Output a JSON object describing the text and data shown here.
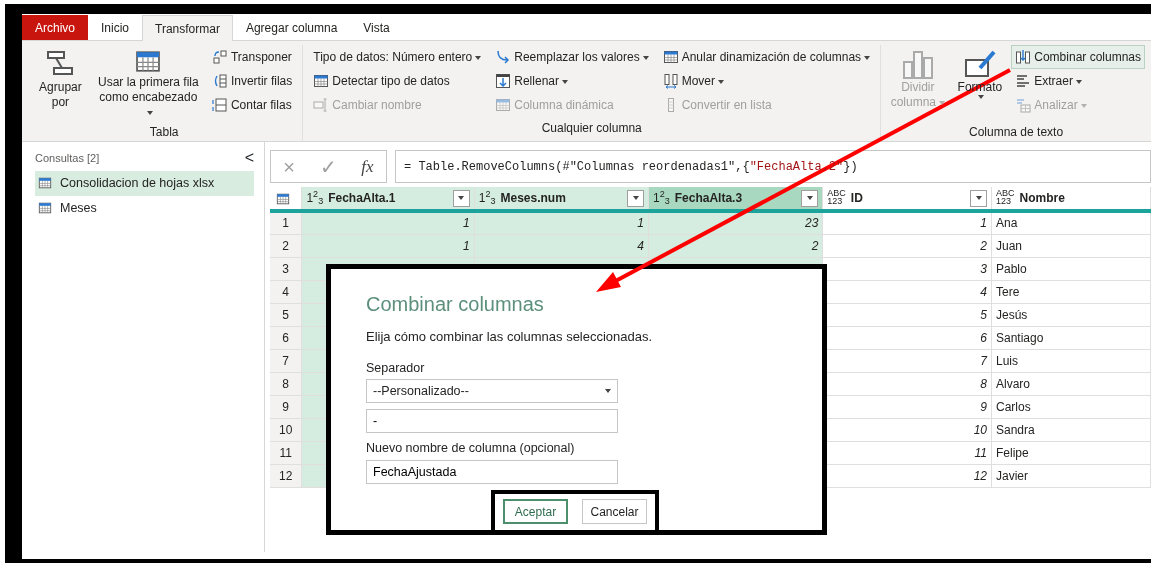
{
  "tabs": [
    {
      "label": "Archivo",
      "kind": "file",
      "selected": false
    },
    {
      "label": "Inicio",
      "kind": "tab",
      "selected": false
    },
    {
      "label": "Transformar",
      "kind": "tab",
      "selected": true
    },
    {
      "label": "Agregar columna",
      "kind": "tab",
      "selected": false
    },
    {
      "label": "Vista",
      "kind": "tab",
      "selected": false
    }
  ],
  "ribbon_groups": [
    {
      "label": "Tabla",
      "columns": [
        [
          {
            "label": "Agrupar por",
            "kind": "large",
            "dropdown": false,
            "disabled": false,
            "highlighted": false
          }
        ],
        [
          {
            "label": "Usar la primera fila como encabezado",
            "kind": "large",
            "dropdown": true,
            "disabled": false,
            "highlighted": false
          }
        ],
        [
          {
            "label": "Transponer",
            "kind": "small",
            "dropdown": false,
            "disabled": false,
            "highlighted": false
          },
          {
            "label": "Invertir filas",
            "kind": "small",
            "dropdown": false,
            "disabled": false,
            "highlighted": false
          },
          {
            "label": "Contar filas",
            "kind": "small",
            "dropdown": false,
            "disabled": false,
            "highlighted": false
          }
        ]
      ]
    },
    {
      "label": "Cualquier columna",
      "columns": [
        [
          {
            "label": "Tipo de datos: Número entero",
            "kind": "plain",
            "dropdown": true,
            "disabled": false,
            "highlighted": false
          },
          {
            "label": "Detectar tipo de datos",
            "kind": "small",
            "dropdown": false,
            "disabled": false,
            "highlighted": false
          },
          {
            "label": "Cambiar nombre",
            "kind": "small",
            "dropdown": false,
            "disabled": true,
            "highlighted": false
          }
        ],
        [
          {
            "label": "Reemplazar los valores",
            "kind": "small",
            "dropdown": true,
            "disabled": false,
            "highlighted": false
          },
          {
            "label": "Rellenar",
            "kind": "small",
            "dropdown": true,
            "disabled": false,
            "highlighted": false
          },
          {
            "label": "Columna dinámica",
            "kind": "small",
            "dropdown": false,
            "disabled": true,
            "highlighted": false
          }
        ],
        [
          {
            "label": "Anular dinamización de columnas",
            "kind": "small",
            "dropdown": true,
            "disabled": false,
            "highlighted": false
          },
          {
            "label": "Mover",
            "kind": "small",
            "dropdown": true,
            "disabled": false,
            "highlighted": false
          },
          {
            "label": "Convertir en lista",
            "kind": "small",
            "dropdown": false,
            "disabled": true,
            "highlighted": false
          }
        ]
      ]
    },
    {
      "label": "Columna de texto",
      "columns": [
        [
          {
            "label": "Dividir columna",
            "kind": "large",
            "dropdown": true,
            "disabled": true,
            "highlighted": false
          }
        ],
        [
          {
            "label": "Formato",
            "kind": "large",
            "dropdown": true,
            "disabled": false,
            "highlighted": false
          }
        ],
        [
          {
            "label": "Combinar columnas",
            "kind": "small",
            "dropdown": false,
            "disabled": false,
            "highlighted": true
          },
          {
            "label": "Extraer",
            "kind": "small",
            "dropdown": true,
            "disabled": false,
            "highlighted": false
          },
          {
            "label": "Analizar",
            "kind": "small",
            "dropdown": true,
            "disabled": true,
            "highlighted": false
          }
        ]
      ]
    }
  ],
  "queries": {
    "title": "Consultas [2]",
    "collapse": "<",
    "items": [
      {
        "label": "Consolidacion de hojas xlsx",
        "selected": true
      },
      {
        "label": "Meses",
        "selected": false
      }
    ]
  },
  "formula_bar": {
    "cancel": "×",
    "confirm": "✓",
    "fx": "fx",
    "segments": [
      {
        "text": "= Table.RemoveColumns(#\"Columnas reordenadas1\",{",
        "kind": "code"
      },
      {
        "text": "\"FechaAlta.2\"",
        "kind": "string"
      },
      {
        "text": "})",
        "kind": "code"
      }
    ]
  },
  "table": {
    "columns": [
      {
        "type_lines": [
          "1$^{2}$$_{3}$"
        ],
        "label": "FechaAlta.1",
        "kind": "number",
        "selected": true,
        "focused": false
      },
      {
        "type_lines": [
          "1$^{2}$$_{3}$"
        ],
        "label": "Meses.num",
        "kind": "number",
        "selected": true,
        "focused": false
      },
      {
        "type_lines": [
          "1$^{2}$$_{3}$"
        ],
        "label": "FechaAlta.3",
        "kind": "number",
        "selected": true,
        "focused": true
      },
      {
        "type_lines": [
          "ABC",
          "123"
        ],
        "label": "ID",
        "kind": "number",
        "selected": false,
        "focused": false
      },
      {
        "type_lines": [
          "ABC",
          "123"
        ],
        "label": "Nombre",
        "kind": "text",
        "selected": false,
        "focused": false
      }
    ],
    "rows": [
      {
        "number": "1",
        "cells": [
          "1",
          "1",
          "23",
          "1",
          "Ana"
        ]
      },
      {
        "number": "2",
        "cells": [
          "1",
          "4",
          "2",
          "2",
          "Juan"
        ]
      },
      {
        "number": "3",
        "cells": [
          null,
          null,
          null,
          "3",
          "Pablo"
        ]
      },
      {
        "number": "4",
        "cells": [
          null,
          null,
          null,
          "4",
          "Tere"
        ]
      },
      {
        "number": "5",
        "cells": [
          null,
          null,
          null,
          "5",
          "Jesús"
        ]
      },
      {
        "number": "6",
        "cells": [
          null,
          null,
          null,
          "6",
          "Santiago"
        ]
      },
      {
        "number": "7",
        "cells": [
          null,
          null,
          null,
          "7",
          "Luis"
        ]
      },
      {
        "number": "8",
        "cells": [
          null,
          null,
          null,
          "8",
          "Alvaro"
        ]
      },
      {
        "number": "9",
        "cells": [
          null,
          null,
          null,
          "9",
          "Carlos"
        ]
      },
      {
        "number": "10",
        "cells": [
          null,
          null,
          null,
          "10",
          "Sandra"
        ]
      },
      {
        "number": "11",
        "cells": [
          null,
          null,
          null,
          "11",
          "Felipe"
        ]
      },
      {
        "number": "12",
        "cells": [
          null,
          null,
          null,
          "12",
          "Javier"
        ]
      }
    ]
  },
  "dialog": {
    "title": "Combinar columnas",
    "description": "Elija cómo combinar las columnas seleccionadas.",
    "separator_label": "Separador",
    "separator_select": "--Personalizado--",
    "separator_value": "-",
    "name_label": "Nuevo nombre de columna (opcional)",
    "name_value": "FechaAjustada",
    "buttons": [
      {
        "label": "Aceptar",
        "kind": "primary"
      },
      {
        "label": "Cancelar",
        "kind": "secondary"
      }
    ]
  }
}
